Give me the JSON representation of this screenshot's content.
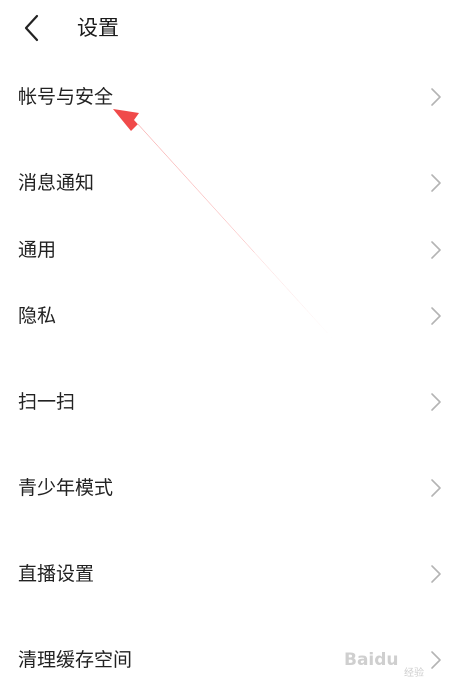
{
  "header": {
    "title": "设置"
  },
  "menu": {
    "items": [
      {
        "label": "帐号与安全"
      },
      {
        "label": "消息通知"
      },
      {
        "label": "通用"
      },
      {
        "label": "隐私"
      },
      {
        "label": "扫一扫"
      },
      {
        "label": "青少年模式"
      },
      {
        "label": "直播设置"
      },
      {
        "label": "清理缓存空间"
      }
    ]
  },
  "annotation": {
    "arrow_color": "#f04a4a"
  },
  "watermark": {
    "brand": "Baidu",
    "sub": "经验"
  }
}
